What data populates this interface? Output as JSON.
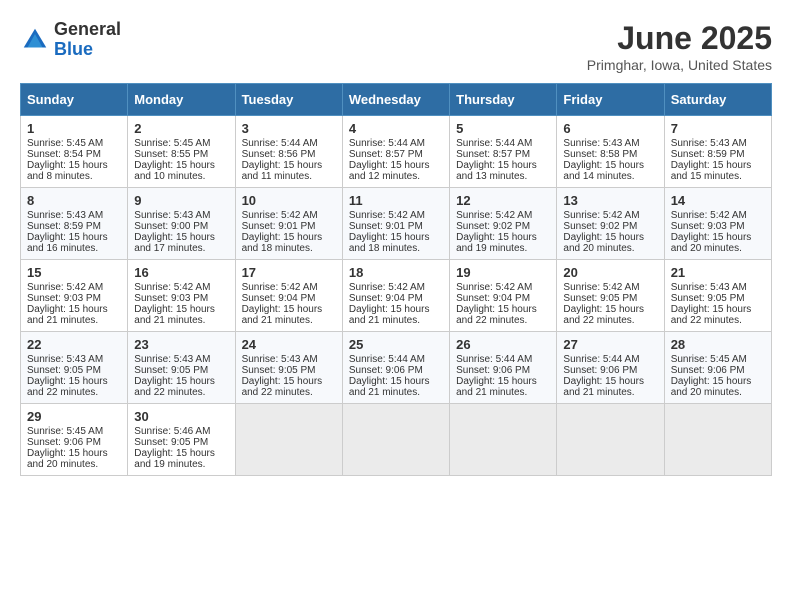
{
  "header": {
    "logo_general": "General",
    "logo_blue": "Blue",
    "title": "June 2025",
    "subtitle": "Primghar, Iowa, United States"
  },
  "calendar": {
    "days_of_week": [
      "Sunday",
      "Monday",
      "Tuesday",
      "Wednesday",
      "Thursday",
      "Friday",
      "Saturday"
    ],
    "weeks": [
      [
        null,
        {
          "day": 2,
          "sunrise": "Sunrise: 5:45 AM",
          "sunset": "Sunset: 8:55 PM",
          "daylight": "Daylight: 15 hours and 10 minutes."
        },
        {
          "day": 3,
          "sunrise": "Sunrise: 5:44 AM",
          "sunset": "Sunset: 8:56 PM",
          "daylight": "Daylight: 15 hours and 11 minutes."
        },
        {
          "day": 4,
          "sunrise": "Sunrise: 5:44 AM",
          "sunset": "Sunset: 8:57 PM",
          "daylight": "Daylight: 15 hours and 12 minutes."
        },
        {
          "day": 5,
          "sunrise": "Sunrise: 5:44 AM",
          "sunset": "Sunset: 8:57 PM",
          "daylight": "Daylight: 15 hours and 13 minutes."
        },
        {
          "day": 6,
          "sunrise": "Sunrise: 5:43 AM",
          "sunset": "Sunset: 8:58 PM",
          "daylight": "Daylight: 15 hours and 14 minutes."
        },
        {
          "day": 7,
          "sunrise": "Sunrise: 5:43 AM",
          "sunset": "Sunset: 8:59 PM",
          "daylight": "Daylight: 15 hours and 15 minutes."
        }
      ],
      [
        {
          "day": 8,
          "sunrise": "Sunrise: 5:43 AM",
          "sunset": "Sunset: 8:59 PM",
          "daylight": "Daylight: 15 hours and 16 minutes."
        },
        {
          "day": 9,
          "sunrise": "Sunrise: 5:43 AM",
          "sunset": "Sunset: 9:00 PM",
          "daylight": "Daylight: 15 hours and 17 minutes."
        },
        {
          "day": 10,
          "sunrise": "Sunrise: 5:42 AM",
          "sunset": "Sunset: 9:01 PM",
          "daylight": "Daylight: 15 hours and 18 minutes."
        },
        {
          "day": 11,
          "sunrise": "Sunrise: 5:42 AM",
          "sunset": "Sunset: 9:01 PM",
          "daylight": "Daylight: 15 hours and 18 minutes."
        },
        {
          "day": 12,
          "sunrise": "Sunrise: 5:42 AM",
          "sunset": "Sunset: 9:02 PM",
          "daylight": "Daylight: 15 hours and 19 minutes."
        },
        {
          "day": 13,
          "sunrise": "Sunrise: 5:42 AM",
          "sunset": "Sunset: 9:02 PM",
          "daylight": "Daylight: 15 hours and 20 minutes."
        },
        {
          "day": 14,
          "sunrise": "Sunrise: 5:42 AM",
          "sunset": "Sunset: 9:03 PM",
          "daylight": "Daylight: 15 hours and 20 minutes."
        }
      ],
      [
        {
          "day": 15,
          "sunrise": "Sunrise: 5:42 AM",
          "sunset": "Sunset: 9:03 PM",
          "daylight": "Daylight: 15 hours and 21 minutes."
        },
        {
          "day": 16,
          "sunrise": "Sunrise: 5:42 AM",
          "sunset": "Sunset: 9:03 PM",
          "daylight": "Daylight: 15 hours and 21 minutes."
        },
        {
          "day": 17,
          "sunrise": "Sunrise: 5:42 AM",
          "sunset": "Sunset: 9:04 PM",
          "daylight": "Daylight: 15 hours and 21 minutes."
        },
        {
          "day": 18,
          "sunrise": "Sunrise: 5:42 AM",
          "sunset": "Sunset: 9:04 PM",
          "daylight": "Daylight: 15 hours and 21 minutes."
        },
        {
          "day": 19,
          "sunrise": "Sunrise: 5:42 AM",
          "sunset": "Sunset: 9:04 PM",
          "daylight": "Daylight: 15 hours and 22 minutes."
        },
        {
          "day": 20,
          "sunrise": "Sunrise: 5:42 AM",
          "sunset": "Sunset: 9:05 PM",
          "daylight": "Daylight: 15 hours and 22 minutes."
        },
        {
          "day": 21,
          "sunrise": "Sunrise: 5:43 AM",
          "sunset": "Sunset: 9:05 PM",
          "daylight": "Daylight: 15 hours and 22 minutes."
        }
      ],
      [
        {
          "day": 22,
          "sunrise": "Sunrise: 5:43 AM",
          "sunset": "Sunset: 9:05 PM",
          "daylight": "Daylight: 15 hours and 22 minutes."
        },
        {
          "day": 23,
          "sunrise": "Sunrise: 5:43 AM",
          "sunset": "Sunset: 9:05 PM",
          "daylight": "Daylight: 15 hours and 22 minutes."
        },
        {
          "day": 24,
          "sunrise": "Sunrise: 5:43 AM",
          "sunset": "Sunset: 9:05 PM",
          "daylight": "Daylight: 15 hours and 22 minutes."
        },
        {
          "day": 25,
          "sunrise": "Sunrise: 5:44 AM",
          "sunset": "Sunset: 9:06 PM",
          "daylight": "Daylight: 15 hours and 21 minutes."
        },
        {
          "day": 26,
          "sunrise": "Sunrise: 5:44 AM",
          "sunset": "Sunset: 9:06 PM",
          "daylight": "Daylight: 15 hours and 21 minutes."
        },
        {
          "day": 27,
          "sunrise": "Sunrise: 5:44 AM",
          "sunset": "Sunset: 9:06 PM",
          "daylight": "Daylight: 15 hours and 21 minutes."
        },
        {
          "day": 28,
          "sunrise": "Sunrise: 5:45 AM",
          "sunset": "Sunset: 9:06 PM",
          "daylight": "Daylight: 15 hours and 20 minutes."
        }
      ],
      [
        {
          "day": 29,
          "sunrise": "Sunrise: 5:45 AM",
          "sunset": "Sunset: 9:06 PM",
          "daylight": "Daylight: 15 hours and 20 minutes."
        },
        {
          "day": 30,
          "sunrise": "Sunrise: 5:46 AM",
          "sunset": "Sunset: 9:05 PM",
          "daylight": "Daylight: 15 hours and 19 minutes."
        },
        null,
        null,
        null,
        null,
        null
      ]
    ],
    "week1_day1": {
      "day": 1,
      "sunrise": "Sunrise: 5:45 AM",
      "sunset": "Sunset: 8:54 PM",
      "daylight": "Daylight: 15 hours and 8 minutes."
    }
  }
}
